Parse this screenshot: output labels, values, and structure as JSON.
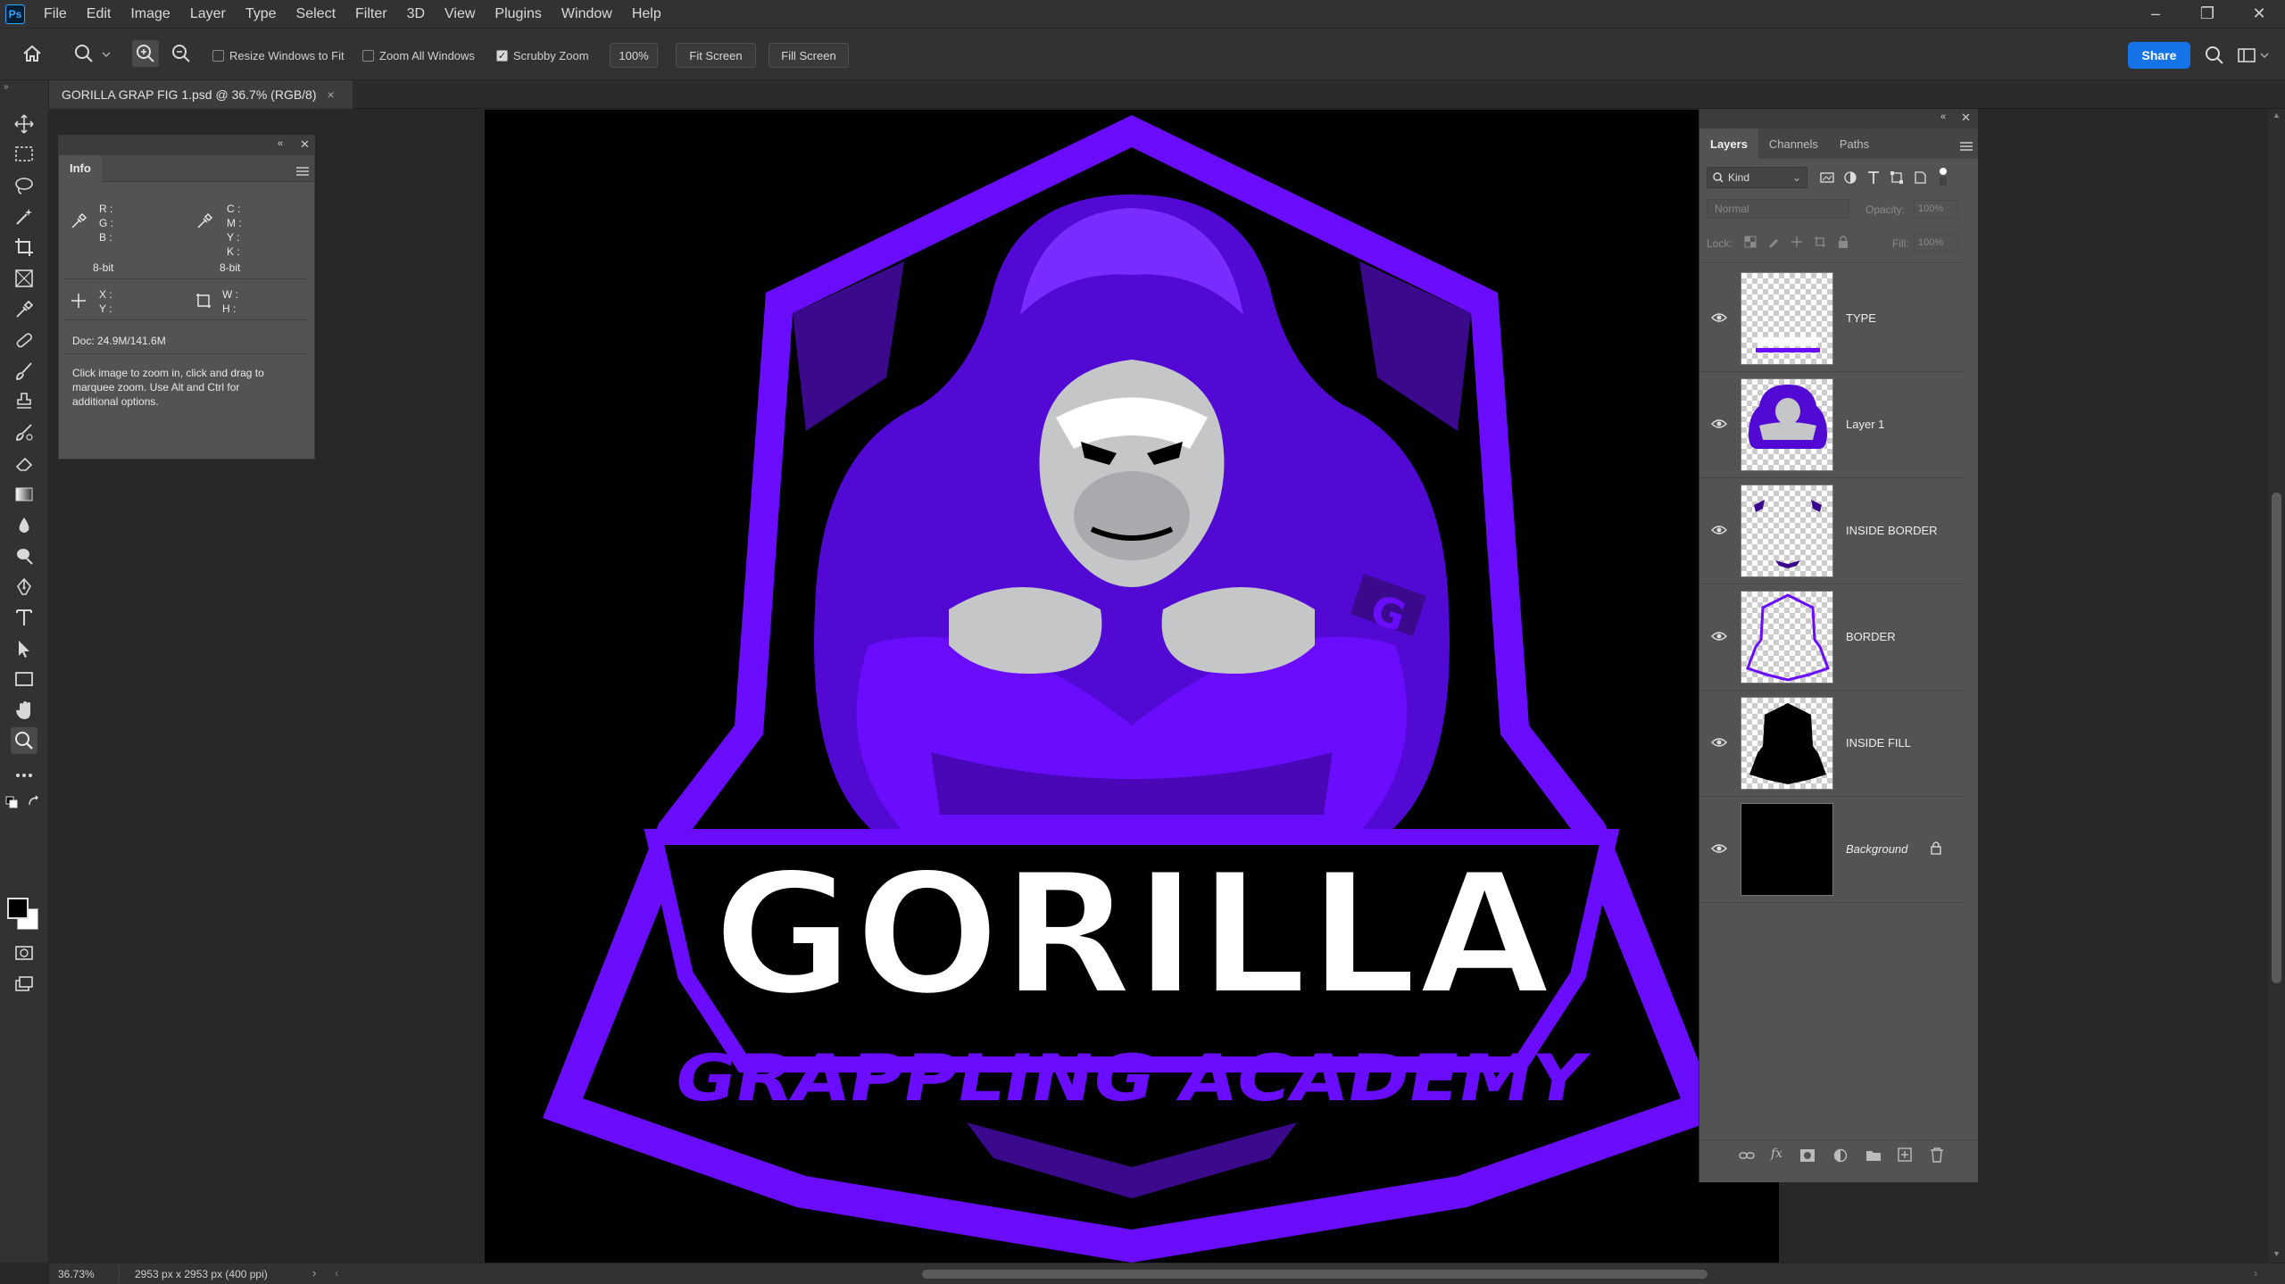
{
  "app": {
    "logo": "Ps"
  },
  "menu": [
    "File",
    "Edit",
    "Image",
    "Layer",
    "Type",
    "Select",
    "Filter",
    "3D",
    "View",
    "Plugins",
    "Window",
    "Help"
  ],
  "window_controls": {
    "minimize": "–",
    "restore": "❐",
    "close": "✕"
  },
  "options": {
    "resize_windows_to_fit": {
      "label": "Resize Windows to Fit",
      "checked": false
    },
    "zoom_all_windows": {
      "label": "Zoom All Windows",
      "checked": false
    },
    "scrubby_zoom": {
      "label": "Scrubby Zoom",
      "checked": true
    },
    "zoom_100": "100%",
    "fit_screen": "Fit Screen",
    "fill_screen": "Fill Screen",
    "share": "Share"
  },
  "document": {
    "tab_title": "GORILLA GRAP FIG 1.psd @ 36.7% (RGB/8)",
    "close": "×"
  },
  "artwork": {
    "colors": {
      "purple": "#6a0dff",
      "dark_purple": "#3b0a8c",
      "mid_purple": "#5209d4",
      "gray": "#c5c6c8",
      "white": "#ffffff"
    },
    "title": "GORILLA",
    "subtitle": "GRAPPLING ACADEMY",
    "chest_letter": "G"
  },
  "info_panel": {
    "tab": "Info",
    "rgb": [
      "R :",
      "G :",
      "B :"
    ],
    "cmyk": [
      "C :",
      "M :",
      "Y :",
      "K :"
    ],
    "bit_left": "8-bit",
    "bit_right": "8-bit",
    "xy": [
      "X :",
      "Y :"
    ],
    "wh": [
      "W :",
      "H :"
    ],
    "doc": "Doc: 24.9M/141.6M",
    "help": [
      "Click image to zoom in, click and drag to",
      "marquee zoom.  Use Alt and Ctrl for",
      "additional options."
    ]
  },
  "layers_panel": {
    "tabs": [
      "Layers",
      "Channels",
      "Paths"
    ],
    "kind": "Kind",
    "blend_mode": "Normal",
    "opacity_label": "Opacity:",
    "opacity_value": "100%",
    "lock_label": "Lock:",
    "fill_label": "Fill:",
    "fill_value": "100%",
    "layers": [
      {
        "name": "TYPE"
      },
      {
        "name": "Layer 1"
      },
      {
        "name": "INSIDE BORDER"
      },
      {
        "name": "BORDER"
      },
      {
        "name": "INSIDE FILL"
      },
      {
        "name": "Background"
      }
    ],
    "footer_icons": [
      "link-icon",
      "fx-icon",
      "mask-icon",
      "adjustment-icon",
      "folder-icon",
      "new-layer-icon",
      "trash-icon"
    ]
  },
  "status": {
    "zoom": "36.73%",
    "doc_info": "2953 px x 2953 px (400 ppi)"
  }
}
